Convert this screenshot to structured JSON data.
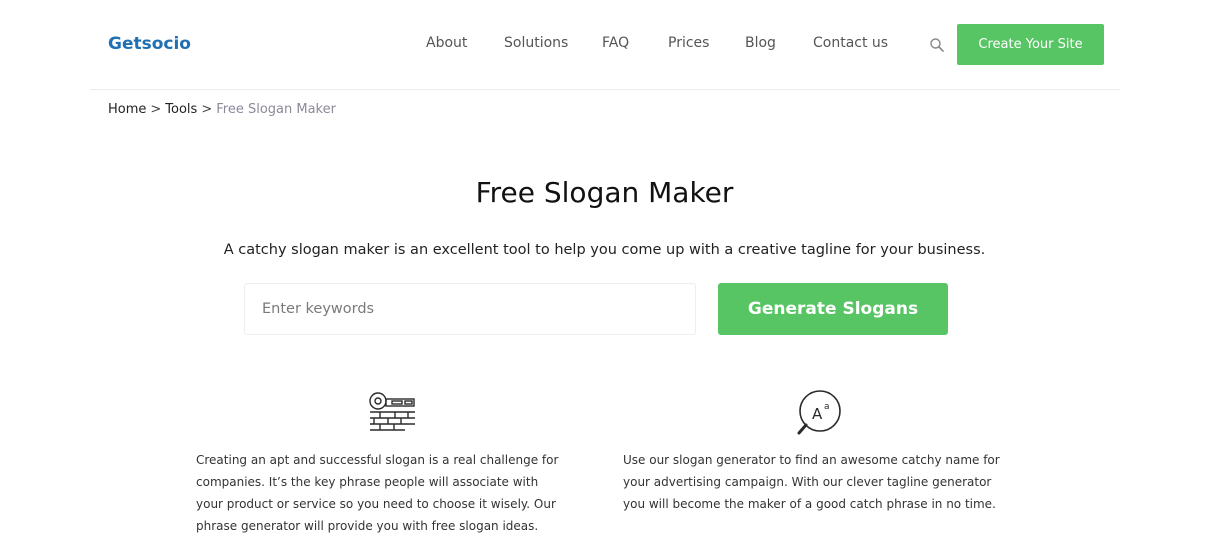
{
  "header": {
    "logo": "Getsocio",
    "nav": [
      "About",
      "Solutions",
      "FAQ",
      "Prices",
      "Blog",
      "Contact us"
    ],
    "search_icon": "search-icon",
    "cta_label": "Create Your Site",
    "accent_color": "#57c563",
    "logo_color": "#1e6fb4"
  },
  "breadcrumb": {
    "home": "Home",
    "tools": "Tools",
    "separator": ">",
    "current": "Free Slogan Maker"
  },
  "main": {
    "title": "Free Slogan Maker",
    "subtitle": "A catchy slogan maker is an excellent tool to help you come up with a creative tagline for your business.",
    "input_placeholder": "Enter keywords",
    "input_value": "",
    "generate_label": "Generate Slogans"
  },
  "features": [
    {
      "icon": "key-puzzle-icon",
      "text": "Creating an apt and successful slogan is a real challenge for companies. It’s the key phrase people will associate with your product or service so you need to choose it wisely. Our phrase generator will provide you with free slogan ideas."
    },
    {
      "icon": "font-search-icon",
      "text": "Use our slogan generator to find an awesome catchy name for your advertising campaign. With our clever tagline generator you will become the maker of a good catch phrase in no time."
    }
  ]
}
